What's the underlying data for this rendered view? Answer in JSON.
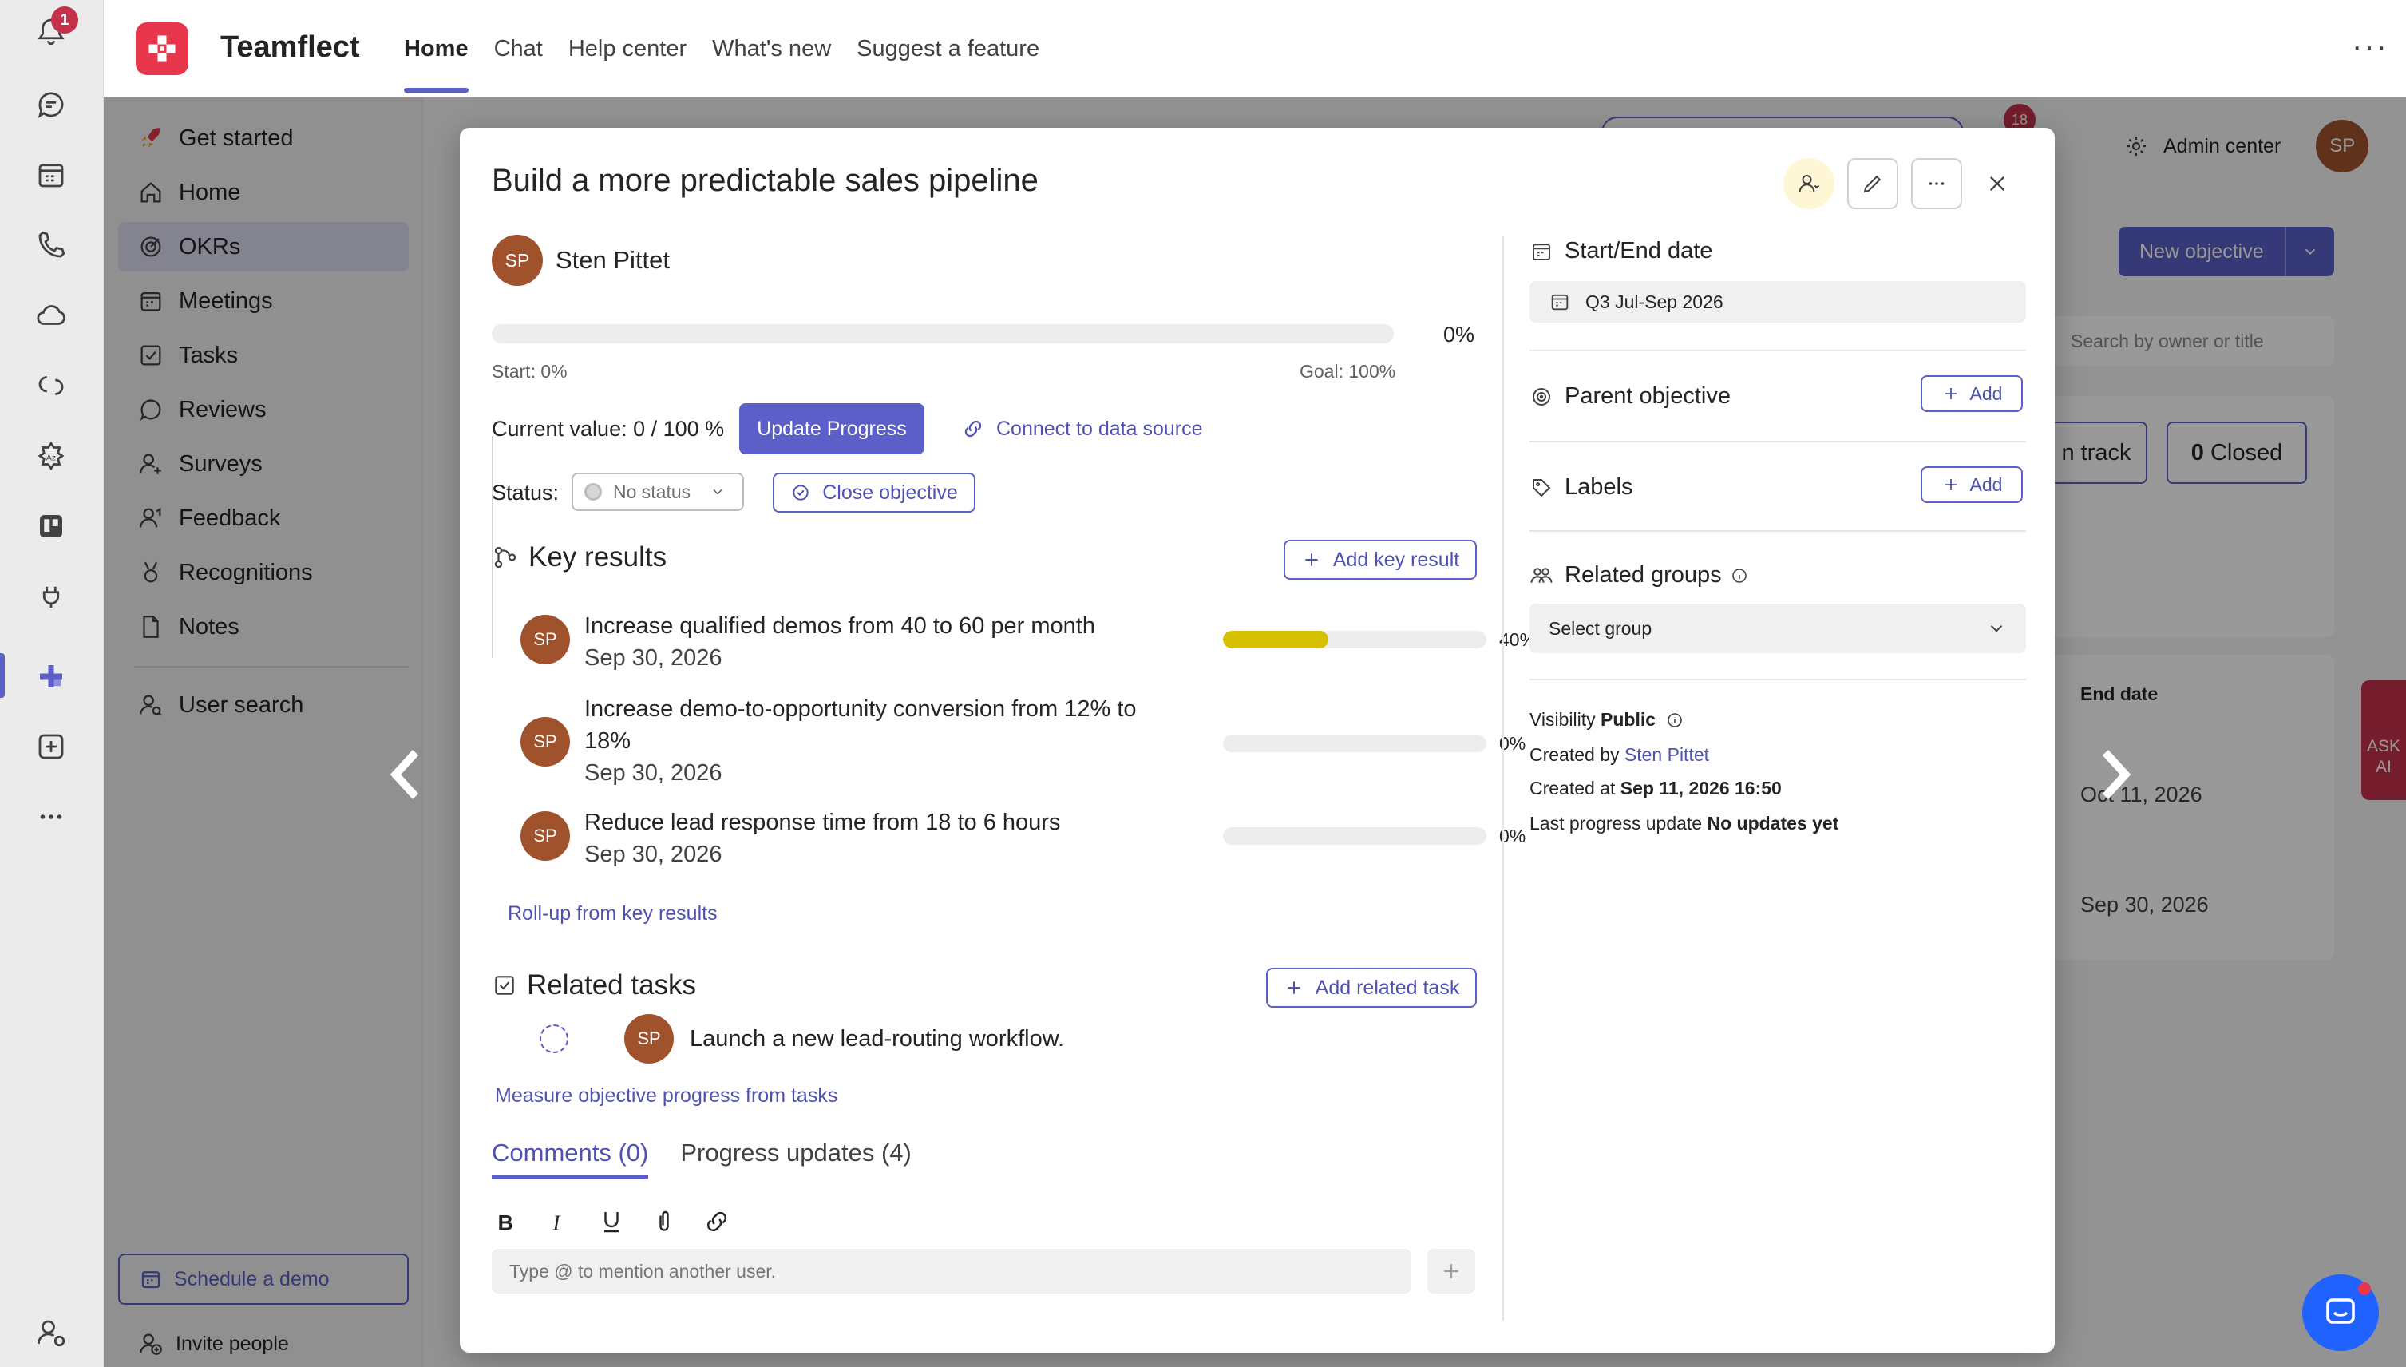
{
  "rail": {
    "notification_count": "1",
    "icons": [
      "bell-icon",
      "chat-icon",
      "calendar-icon",
      "phone-icon",
      "cloud-icon",
      "loop-icon",
      "ai-apps-icon",
      "planner-icon",
      "plugin-icon",
      "teamflect-icon",
      "add-app-icon",
      "more-icon"
    ]
  },
  "topbar": {
    "app_name": "Teamflect",
    "tabs": [
      "Home",
      "Chat",
      "Help center",
      "What's new",
      "Suggest a feature"
    ],
    "active_tab": "Home",
    "more": "···"
  },
  "sidebar": {
    "items": [
      {
        "label": "Get started",
        "icon": "rocket-icon"
      },
      {
        "label": "Home",
        "icon": "home-icon"
      },
      {
        "label": "OKRs",
        "icon": "target-icon",
        "active": true
      },
      {
        "label": "Meetings",
        "icon": "calendar-icon"
      },
      {
        "label": "Tasks",
        "icon": "checkbox-icon"
      },
      {
        "label": "Reviews",
        "icon": "comment-icon"
      },
      {
        "label": "Surveys",
        "icon": "person-survey-icon"
      },
      {
        "label": "Feedback",
        "icon": "person-feedback-icon"
      },
      {
        "label": "Recognitions",
        "icon": "medal-icon"
      },
      {
        "label": "Notes",
        "icon": "note-icon"
      }
    ],
    "user_search": "User search",
    "schedule_demo": "Schedule a demo",
    "invite_people": "Invite people"
  },
  "background": {
    "admin_center": "Admin center",
    "avatar_initials": "SP",
    "notification_count": "18",
    "new_objective": "New objective",
    "search_placeholder": "Search by owner or title",
    "on_track": "n track",
    "closed_count": "0",
    "closed_label": "Closed",
    "end_date_col": "End date",
    "row1_date": "Oct 11, 2026",
    "row2_date": "Sep 30, 2026",
    "ask_ai": "ASK AI"
  },
  "modal": {
    "title": "Build a more predictable sales pipeline",
    "owner": {
      "name": "Sten Pittet",
      "initials": "SP"
    },
    "progress": {
      "percent_label": "0%",
      "value": 0,
      "start": "Start: 0%",
      "goal": "Goal: 100%"
    },
    "current_value": "Current value: 0 / 100 %",
    "update_progress": "Update Progress",
    "connect_data_source": "Connect to data source",
    "status_label": "Status:",
    "status_value": "No status",
    "close_objective": "Close objective",
    "key_results_title": "Key results",
    "add_key_result": "Add key result",
    "key_results": [
      {
        "title": "Increase qualified demos from 40 to 60 per month",
        "date": "Sep 30, 2026",
        "progress": 40,
        "pct": "40%",
        "initials": "SP"
      },
      {
        "title": "Increase demo-to-opportunity conversion from 12% to 18%",
        "date": "Sep 30, 2026",
        "progress": 0,
        "pct": "0%",
        "initials": "SP"
      },
      {
        "title": "Reduce lead response time from 18 to 6 hours",
        "date": "Sep 30, 2026",
        "progress": 0,
        "pct": "0%",
        "initials": "SP"
      }
    ],
    "rollup_link": "Roll-up from key results",
    "related_tasks_title": "Related tasks",
    "add_related_task": "Add related task",
    "task": {
      "title": "Launch a new lead-routing workflow.",
      "initials": "SP"
    },
    "measure_link": "Measure objective progress from tasks",
    "tabs": {
      "comments": "Comments (0)",
      "progress_updates": "Progress updates (4)"
    },
    "comment_placeholder": "Type @ to mention another user.",
    "right": {
      "start_end_label": "Start/End date",
      "start_end_value": "Q3 Jul-Sep 2026",
      "parent_objective_label": "Parent objective",
      "labels_label": "Labels",
      "add": "Add",
      "related_groups_label": "Related groups",
      "select_group": "Select group",
      "visibility_label": "Visibility",
      "visibility_value": "Public",
      "created_by_label": "Created by",
      "created_by_value": "Sten Pittet",
      "created_at_label": "Created at",
      "created_at_value": "Sep 11, 2026 16:50",
      "last_update_label": "Last progress update",
      "last_update_value": "No updates yet"
    }
  },
  "colors": {
    "accent": "#5b5fc7",
    "brand": "#e8364c",
    "progress_fill": "#d4c000",
    "avatar": "#a0522d"
  }
}
